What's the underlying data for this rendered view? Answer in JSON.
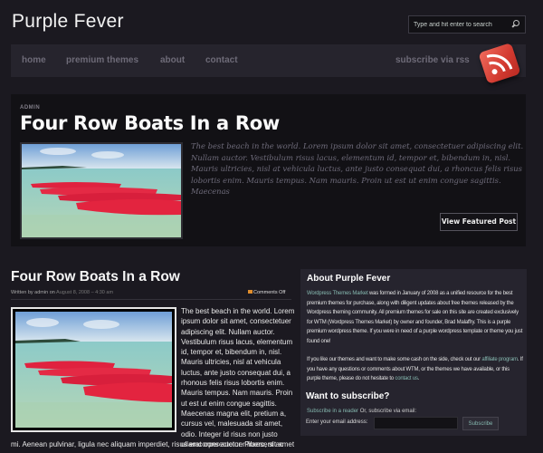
{
  "site": {
    "title": "Purple Fever"
  },
  "search": {
    "placeholder": "Type and hit enter to search",
    "icon": "search-icon"
  },
  "nav": {
    "items": [
      {
        "label": "home"
      },
      {
        "label": "premium themes"
      },
      {
        "label": "about"
      },
      {
        "label": "contact"
      }
    ],
    "rss_label": "subscribe via rss",
    "rss_icon": "rss-icon"
  },
  "featured": {
    "author": "ADMIN",
    "title": "Four Row Boats In a Row",
    "image_alt": "Red kayaks on a tropical beach",
    "excerpt": "The best beach in the world. Lorem ipsum dolor sit amet, consectetuer adipiscing elit. Nullam auctor. Vestibulum risus lacus, elementum id, tempor et, bibendum in, nisl. Mauris ultricies, nisl at vehicula luctus, ante justo consequat dui, a rhoncus felis risus lobortis enim. Mauris tempus. Nam mauris. Proin ut est ut enim congue sagittis. Maecenas",
    "button_label": "View Featured Post"
  },
  "post": {
    "title": "Four Row Boats In a Row",
    "meta_prefix": "Written by admin on",
    "date": "August 8, 2008 – 4:30 am",
    "comments": "Comments Off",
    "image_alt": "Red kayaks on a tropical beach",
    "body_side": "The best beach in the world. Lorem ipsum dolor sit amet, consectetuer adipiscing elit. Nullam auctor. Vestibulum risus lacus, elementum id, tempor et, bibendum in, nisl. Mauris ultricies, nisl at vehicula luctus, ante justo consequat dui, a rhonous felis risus lobortis enim. Mauris tempus. Nam mauris. Proin ut est ut enim congue sagittis. Maecenas magna elit, pretium a, cursus vel, malesuada sit amet, odio. Integer id risus non justo ullamcorper auctor. Praesent ac",
    "body_wide": "mi. Aenean pulvinar, ligula nec aliquam imperdiet, risus erat consectetuer libero, sit amet"
  },
  "sidebar": {
    "about_title": "About Purple Fever",
    "about_link": "Wordpress Themes Market",
    "about_text": " was formed in January of 2008 as a unified resource for the best premium themes for purchase, along with diligent updates about free themes released by the Wordpress theming community. All premium themes for sale on this site are created exclusively for WTM (Wordpress Themes Market) by owner and founder, Brad Malaffry. This is a purple premium wordpress theme. If you were in need of a purple wordpress template or theme you just found one!",
    "affiliate_text_1": "If you like our themes and want to make some cash on the side, check out our ",
    "affiliate_link": "affiliate program",
    "affiliate_text_2": ". If you have any questions or comments about WTM, or the themes we have available, or this purple theme, please do not hesitate to ",
    "contact_link": "contact us",
    "affiliate_text_3": ".",
    "subscribe_title": "Want to subscribe?",
    "reader_link": "Subscribe in a reader",
    "reader_text": " Or, subscribe via email:",
    "email_label": "Enter your email address:",
    "email_value": "",
    "subscribe_button": "Subscribe"
  }
}
